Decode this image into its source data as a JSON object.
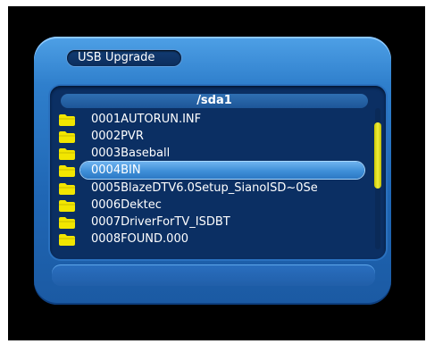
{
  "window": {
    "title": "USB Upgrade"
  },
  "browser": {
    "path": "/sda1",
    "items": [
      {
        "label": "0001AUTORUN.INF",
        "selected": false
      },
      {
        "label": "0002PVR",
        "selected": false
      },
      {
        "label": "0003Baseball",
        "selected": false
      },
      {
        "label": "0004BIN",
        "selected": true
      },
      {
        "label": "0005BlazeDTV6.0Setup_SianoISD~0Se",
        "selected": false
      },
      {
        "label": "0006Dektec",
        "selected": false
      },
      {
        "label": "0007DriverForTV_ISDBT",
        "selected": false
      },
      {
        "label": "0008FOUND.000",
        "selected": false
      }
    ],
    "item_icon": "folder-icon"
  },
  "colors": {
    "panel": "#2f7fcc",
    "list_background": "#0b2f63",
    "highlight": "#3f8fd8",
    "folder": "#f2e600",
    "scrollbar": "#f0ee3a"
  }
}
